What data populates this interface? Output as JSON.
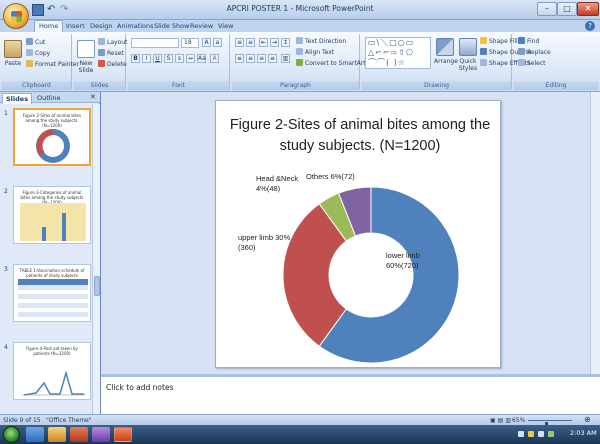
{
  "window": {
    "title": "APCRI POSTER 1 - Microsoft PowerPoint"
  },
  "tabs": [
    "Home",
    "Insert",
    "Design",
    "Animations",
    "Slide Show",
    "Review",
    "View"
  ],
  "ribbon": {
    "clipboard": {
      "label": "Clipboard",
      "paste": "Paste",
      "cut": "Cut",
      "copy": "Copy",
      "format_painter": "Format Painter"
    },
    "slides": {
      "label": "Slides",
      "new_slide": "New Slide",
      "layout": "Layout",
      "reset": "Reset",
      "delete": "Delete"
    },
    "font": {
      "label": "Font",
      "size": "18"
    },
    "paragraph": {
      "label": "Paragraph",
      "text_direction": "Text Direction",
      "align_text": "Align Text",
      "convert_smartart": "Convert to SmartArt"
    },
    "drawing": {
      "label": "Drawing",
      "arrange": "Arrange",
      "quick_styles": "Quick Styles",
      "shape_fill": "Shape Fill",
      "shape_outline": "Shape Outline",
      "shape_effects": "Shape Effects"
    },
    "editing": {
      "label": "Editing",
      "find": "Find",
      "replace": "Replace",
      "select": "Select"
    }
  },
  "pane": {
    "tabs": [
      "Slides",
      "Outline"
    ]
  },
  "thumbnails": [
    {
      "num": "1",
      "caption": "Figure 2-Sites of animal bites among the study subjects. (N=1200)"
    },
    {
      "num": "2",
      "caption": "Figure 3-Categories of animal bites among the study subjects (N=1200)"
    },
    {
      "num": "3",
      "caption": "TABLE 1-Vaccination schedule of patients of study subjects"
    },
    {
      "num": "4",
      "caption": "Figure 4-Post aid taken by patients (N=1200)"
    }
  ],
  "slide": {
    "title": "Figure 2-Sites of animal bites among the study subjects. (N=1200)"
  },
  "chart_data": {
    "type": "pie",
    "categories": [
      "lower limb",
      "upper limb",
      "Head &Neck",
      "Others"
    ],
    "values": [
      60,
      30,
      4,
      6
    ],
    "data_labels": [
      "lower limb 60%(720)",
      "upper limb 30% (360)",
      "Head &Neck 4%(48)",
      "Others 6%(72)"
    ],
    "colors": [
      "#4f81bd",
      "#c0504d",
      "#9bbb59",
      "#8064a2"
    ],
    "legend": "none"
  },
  "notes": {
    "placeholder": "Click to add notes"
  },
  "status": {
    "slide_info": "Slide 9 of 15",
    "theme": "\"Office Theme\"",
    "zoom": "65%"
  },
  "taskbar": {
    "time": "2:03 AM"
  },
  "icons": [
    "office-button-icon",
    "save-icon",
    "undo-icon",
    "redo-icon",
    "help-icon",
    "start-icon"
  ]
}
